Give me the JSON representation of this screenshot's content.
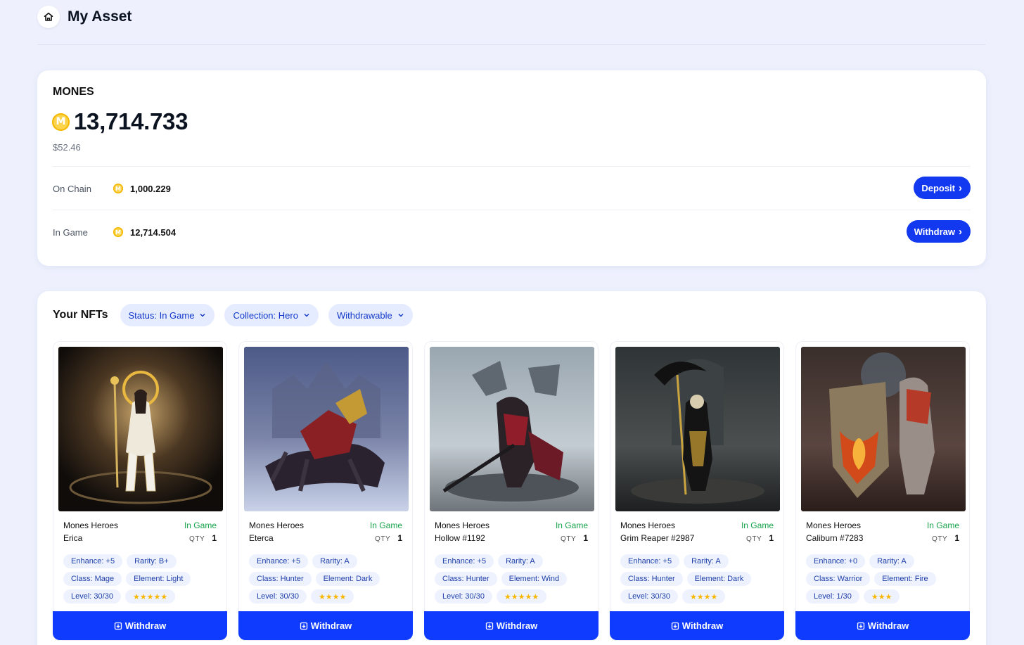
{
  "header": {
    "title": "My Asset",
    "home_icon": "home-icon"
  },
  "token": {
    "name": "MONES",
    "balance": "13,714.733",
    "usd": "$52.46",
    "coin_color": "#f5b800",
    "coin_glyph": "M",
    "on_chain": {
      "label": "On Chain",
      "value": "1,000.229",
      "action": "Deposit"
    },
    "in_game": {
      "label": "In Game",
      "value": "12,714.504",
      "action": "Withdraw"
    },
    "chevron": "›"
  },
  "nfts": {
    "title": "Your NFTs",
    "filters": [
      {
        "label": "Status: In Game"
      },
      {
        "label": "Collection: Hero"
      },
      {
        "label": "Withdrawable"
      }
    ],
    "qty_label": "QTY",
    "withdraw_label": "Withdraw",
    "status_color": "#16a34a",
    "accent": "#0f3bff",
    "items": [
      {
        "collection": "Mones Heroes",
        "name": "Erica",
        "status": "In Game",
        "qty": "1",
        "tags": [
          "Enhance: +5",
          "Rarity: B+",
          "Class: Mage",
          "Element: Light",
          "Level: 30/30"
        ],
        "stars": 5,
        "stars_text": "★★★★★"
      },
      {
        "collection": "Mones Heroes",
        "name": "Eterca",
        "status": "In Game",
        "qty": "1",
        "tags": [
          "Enhance: +5",
          "Rarity: A",
          "Class: Hunter",
          "Element: Dark",
          "Level: 30/30"
        ],
        "stars": 4,
        "stars_text": "★★★★"
      },
      {
        "collection": "Mones Heroes",
        "name": "Hollow #1192",
        "status": "In Game",
        "qty": "1",
        "tags": [
          "Enhance: +5",
          "Rarity: A",
          "Class: Hunter",
          "Element: Wind",
          "Level: 30/30"
        ],
        "stars": 5,
        "stars_text": "★★★★★"
      },
      {
        "collection": "Mones Heroes",
        "name": "Grim Reaper #2987",
        "status": "In Game",
        "qty": "1",
        "tags": [
          "Enhance: +5",
          "Rarity: A",
          "Class: Hunter",
          "Element: Dark",
          "Level: 30/30"
        ],
        "stars": 4,
        "stars_text": "★★★★"
      },
      {
        "collection": "Mones Heroes",
        "name": "Caliburn #7283",
        "status": "In Game",
        "qty": "1",
        "tags": [
          "Enhance: +0",
          "Rarity: A",
          "Class: Warrior",
          "Element: Fire",
          "Level: 1/30"
        ],
        "stars": 3,
        "stars_text": "★★★"
      }
    ]
  }
}
